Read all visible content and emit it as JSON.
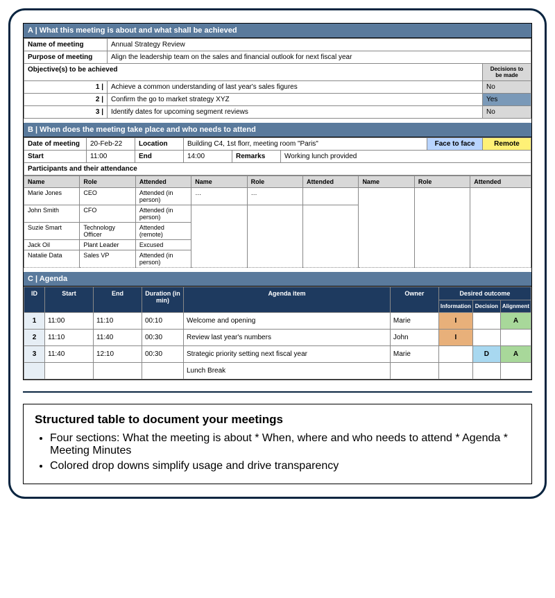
{
  "sectionA": {
    "header": "A | What this meeting is about and what shall be achieved",
    "nameLabel": "Name of meeting",
    "nameValue": "Annual Strategy Review",
    "purposeLabel": "Purpose of meeting",
    "purposeValue": "Align the leadership team on the sales and financial outlook for next fiscal year",
    "objectivesLabel": "Objective(s) to be achieved",
    "decisionsLabel": "Decisions to be made",
    "objectives": [
      {
        "n": "1 |",
        "text": "Achieve a common understanding of last year's sales figures",
        "decision": "No"
      },
      {
        "n": "2 |",
        "text": "Confirm the go to market strategy XYZ",
        "decision": "Yes"
      },
      {
        "n": "3 |",
        "text": "Identify dates for upcoming segment reviews",
        "decision": "No"
      }
    ]
  },
  "sectionB": {
    "header": "B | When does the meeting take place and who needs to attend",
    "dateLabel": "Date of meeting",
    "dateValue": "20-Feb-22",
    "locationLabel": "Location",
    "locationValue": "Building C4, 1st florr, meeting room \"Paris\"",
    "f2f": "Face to face",
    "remote": "Remote",
    "startLabel": "Start",
    "startValue": "11:00",
    "endLabel": "End",
    "endValue": "14:00",
    "remarksLabel": "Remarks",
    "remarksValue": "Working lunch provided",
    "participantsLabel": "Participants and their attendance",
    "cols": {
      "name": "Name",
      "role": "Role",
      "attended": "Attended"
    },
    "participants": [
      {
        "name": "Marie Jones",
        "role": "CEO",
        "attended": "Attended (in person)"
      },
      {
        "name": "John Smith",
        "role": "CFO",
        "attended": "Attended (in person)"
      },
      {
        "name": "Suzie Smart",
        "role": "Technology Officer",
        "attended": "Attended (remote)"
      },
      {
        "name": "Jack Oil",
        "role": "Plant Leader",
        "attended": "Excused"
      },
      {
        "name": "Natalie Data",
        "role": "Sales VP",
        "attended": "Attended (in person)"
      }
    ],
    "placeholder": "…"
  },
  "sectionC": {
    "header": "C | Agenda",
    "cols": {
      "id": "ID",
      "start": "Start",
      "end": "End",
      "duration": "Duration (in min)",
      "item": "Agenda item",
      "owner": "Owner",
      "outcome": "Desired outcome",
      "info": "Information",
      "decision": "Decision",
      "alignment": "Alignment"
    },
    "rows": [
      {
        "id": "1",
        "start": "11:00",
        "end": "11:10",
        "dur": "00:10",
        "item": "Welcome and opening",
        "owner": "Marie",
        "i": "I",
        "d": "",
        "a": "A"
      },
      {
        "id": "2",
        "start": "11:10",
        "end": "11:40",
        "dur": "00:30",
        "item": "Review last year's numbers",
        "owner": "John",
        "i": "I",
        "d": "",
        "a": ""
      },
      {
        "id": "3",
        "start": "11:40",
        "end": "12:10",
        "dur": "00:30",
        "item": "Strategic priority setting next fiscal year",
        "owner": "Marie",
        "i": "",
        "d": "D",
        "a": "A"
      },
      {
        "id": "",
        "start": "",
        "end": "",
        "dur": "",
        "item": "Lunch Break",
        "owner": "",
        "i": "",
        "d": "",
        "a": ""
      }
    ]
  },
  "description": {
    "title": "Structured table to document your meetings",
    "bullets": [
      "Four sections: What the meeting is about * When, where and who needs to attend * Agenda * Meeting Minutes",
      "Colored drop downs simplify usage and drive transparency"
    ]
  }
}
